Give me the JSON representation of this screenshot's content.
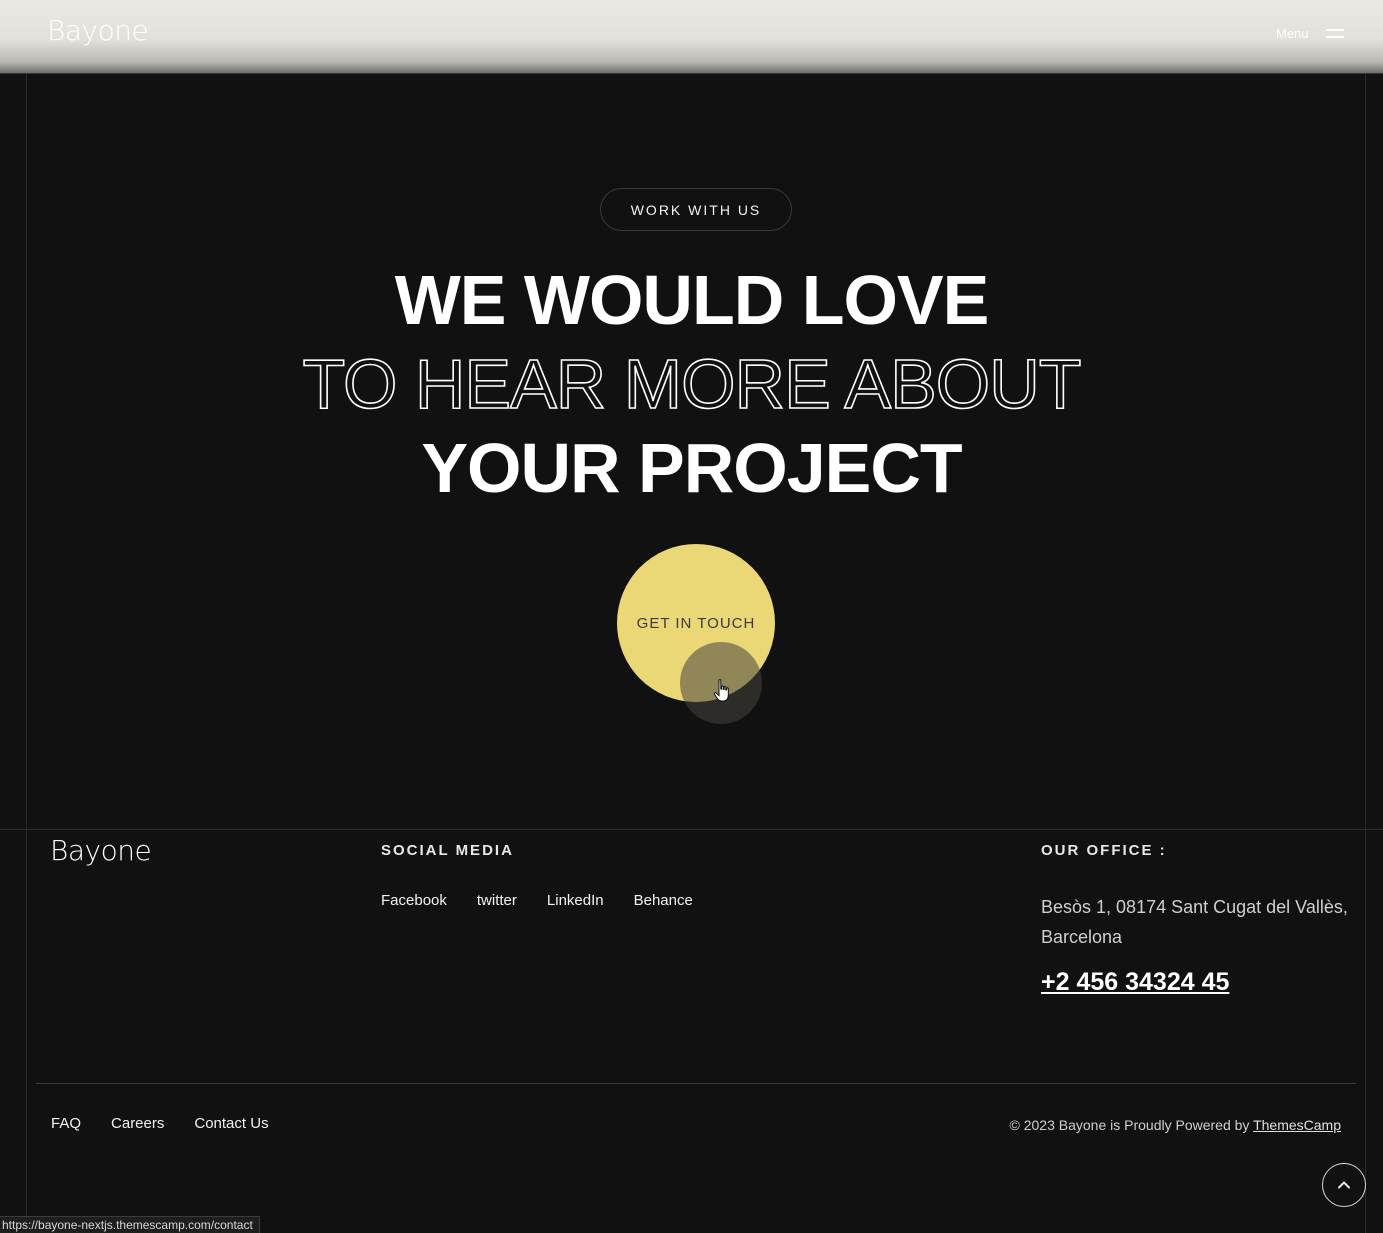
{
  "header": {
    "logo": "Bayone",
    "menu_label": "Menu"
  },
  "hero": {
    "badge": "WORK WITH US",
    "line1": "WE WOULD LOVE",
    "line2": "TO HEAR MORE ABOUT",
    "line3": "YOUR PROJECT",
    "cta_label": "GET IN TOUCH"
  },
  "footer": {
    "logo": "Bayone",
    "social_title": "SOCIAL MEDIA",
    "social_links": [
      "Facebook",
      "twitter",
      "LinkedIn",
      "Behance"
    ],
    "office_title": "OUR OFFICE :",
    "office_address": "Besòs 1, 08174 Sant Cugat del Vallès, Barcelona",
    "office_phone": "+2 456 34324 45",
    "bottom_links": [
      "FAQ",
      "Careers",
      "Contact Us"
    ],
    "copyright_prefix": "© 2023 Bayone is Proudly Powered by ",
    "copyright_link": "ThemesCamp"
  },
  "status_bar": {
    "url": "https://bayone-nextjs.themescamp.com/contact"
  },
  "colors": {
    "background": "#121111",
    "accent": "#ead776",
    "header_bg": "#e2e0db"
  },
  "icons": {
    "menu": "hamburger-icon",
    "scroll_top": "chevron-up-icon",
    "cursor": "hand-pointer-icon"
  }
}
